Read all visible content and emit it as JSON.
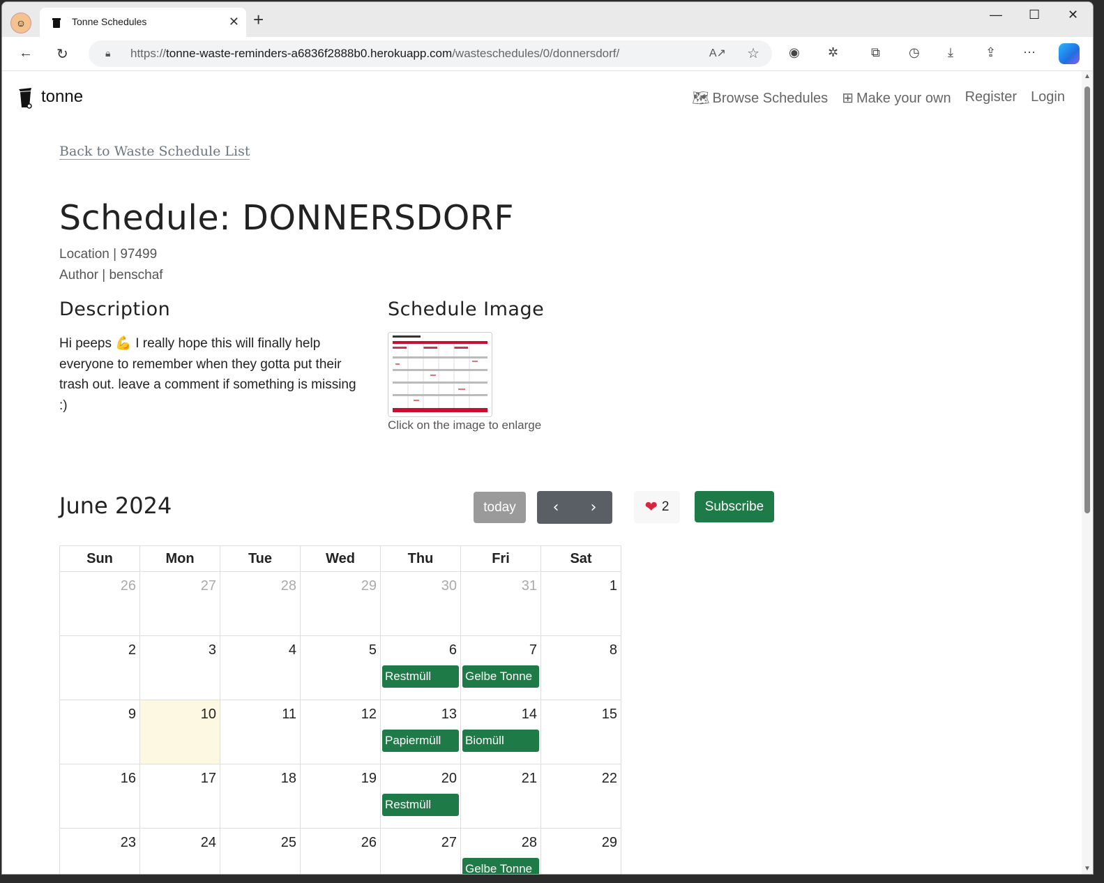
{
  "browser": {
    "tab_title": "Tonne Schedules",
    "url_prefix": "https://",
    "url_host": "tonne-waste-reminders-a6836f2888b0.herokuapp.com",
    "url_path": "/wasteschedules/0/donnersdorf/"
  },
  "site": {
    "brand": "tonne",
    "nav": {
      "browse": "Browse Schedules",
      "make": "Make your own",
      "register": "Register",
      "login": "Login"
    }
  },
  "schedule": {
    "back_link": "Back to Waste Schedule List",
    "title": "Schedule: DONNERSDORF",
    "location": "Location | 97499",
    "author": "Author | benschaf",
    "description_heading": "Description",
    "description": "Hi peeps 💪 I really hope this will finally help everyone to remember when they gotta put their trash out. leave a comment if something is missing :)",
    "image_heading": "Schedule Image",
    "image_caption": "Click on the image to enlarge"
  },
  "calendar": {
    "month": "June 2024",
    "today_label": "today",
    "prev_icon": "chevron-left-icon",
    "next_icon": "chevron-right-icon",
    "likes": "2",
    "subscribe_label": "Subscribe",
    "weekdays": [
      "Sun",
      "Mon",
      "Tue",
      "Wed",
      "Thu",
      "Fri",
      "Sat"
    ],
    "weeks": [
      [
        {
          "d": "26",
          "other": true
        },
        {
          "d": "27",
          "other": true
        },
        {
          "d": "28",
          "other": true
        },
        {
          "d": "29",
          "other": true
        },
        {
          "d": "30",
          "other": true
        },
        {
          "d": "31",
          "other": true
        },
        {
          "d": "1"
        }
      ],
      [
        {
          "d": "2"
        },
        {
          "d": "3"
        },
        {
          "d": "4"
        },
        {
          "d": "5"
        },
        {
          "d": "6",
          "event": "Restmüll"
        },
        {
          "d": "7",
          "event": "Gelbe Tonne"
        },
        {
          "d": "8"
        }
      ],
      [
        {
          "d": "9"
        },
        {
          "d": "10",
          "today": true
        },
        {
          "d": "11"
        },
        {
          "d": "12"
        },
        {
          "d": "13",
          "event": "Papiermüll"
        },
        {
          "d": "14",
          "event": "Biomüll"
        },
        {
          "d": "15"
        }
      ],
      [
        {
          "d": "16"
        },
        {
          "d": "17"
        },
        {
          "d": "18"
        },
        {
          "d": "19"
        },
        {
          "d": "20",
          "event": "Restmüll"
        },
        {
          "d": "21"
        },
        {
          "d": "22"
        }
      ],
      [
        {
          "d": "23"
        },
        {
          "d": "24"
        },
        {
          "d": "25"
        },
        {
          "d": "26"
        },
        {
          "d": "27"
        },
        {
          "d": "28",
          "event": "Gelbe Tonne"
        },
        {
          "d": "29"
        }
      ]
    ],
    "event_color": "#1e7a46",
    "today_color": "#fdf8e1"
  }
}
